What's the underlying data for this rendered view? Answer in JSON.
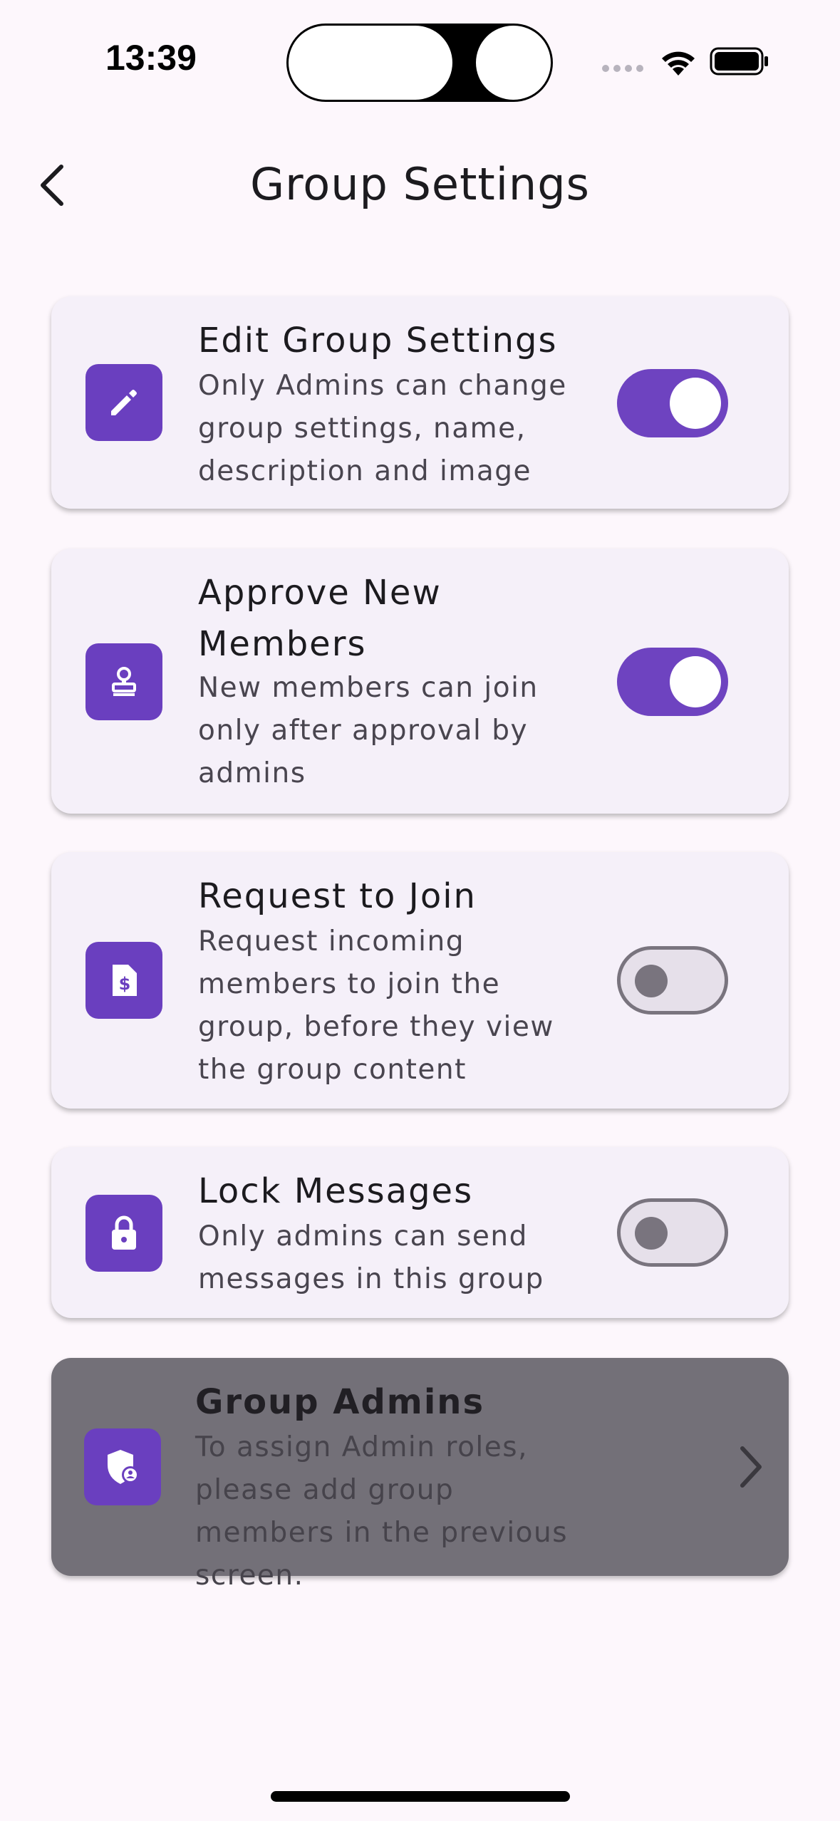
{
  "status_bar": {
    "time": "13:39"
  },
  "header": {
    "title": "Group Settings"
  },
  "settings": [
    {
      "title": "Edit Group Settings",
      "description": "Only Admins can change group settings, name, description and image",
      "icon": "pencil-icon",
      "enabled": true
    },
    {
      "title": "Approve New Members",
      "description": "New members can join only after approval by admins",
      "icon": "stamp-icon",
      "enabled": true
    },
    {
      "title": "Request to Join",
      "description": "Request incoming members to join the group, before they view the group content",
      "icon": "dollar-document-icon",
      "enabled": false
    },
    {
      "title": "Lock Messages",
      "description": "Only admins can send messages in this group",
      "icon": "lock-icon",
      "enabled": false
    }
  ],
  "group_admins": {
    "title": "Group Admins",
    "description": "To assign Admin roles, please add group members in the previous screen.",
    "icon": "admin-shield-icon"
  },
  "colors": {
    "accent": "#6e43c0",
    "icon_bg": "#6a3fbf",
    "card_bg": "#f5f0f9",
    "disabled_card_bg": "#737078",
    "page_bg": "#fdf7fc"
  }
}
